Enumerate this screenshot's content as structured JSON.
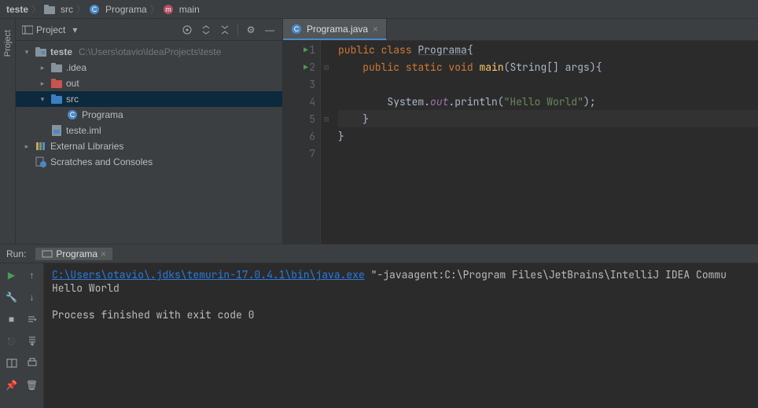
{
  "breadcrumbs": {
    "root": "teste",
    "folder": "src",
    "class": "Programa",
    "method": "main"
  },
  "project_panel": {
    "title": "Project",
    "root_name": "teste",
    "root_path": "C:\\Users\\otavio\\IdeaProjects\\teste",
    "items": {
      "idea": ".idea",
      "out": "out",
      "src": "src",
      "programa": "Programa",
      "iml": "teste.iml",
      "ext_libs": "External Libraries",
      "scratches": "Scratches and Consoles"
    }
  },
  "tabs": {
    "active": "Programa.java"
  },
  "code": {
    "l1_a": "public",
    "l1_b": " class ",
    "l1_c": "Programa",
    "l1_d": "{",
    "l2_a": "    public",
    "l2_b": " static",
    "l2_c": " void ",
    "l2_d": "main",
    "l2_e": "(String[] args)",
    "l2_f": "{",
    "l3": "",
    "l4_a": "        System.",
    "l4_b": "out",
    "l4_c": ".println(",
    "l4_d": "\"Hello World\"",
    "l4_e": ");",
    "l5": "    }",
    "l6": "}",
    "l7": ""
  },
  "gutter": {
    "n1": "1",
    "n2": "2",
    "n3": "3",
    "n4": "4",
    "n5": "5",
    "n6": "6",
    "n7": "7"
  },
  "run": {
    "label": "Run:",
    "config_name": "Programa",
    "java_path": "C:\\Users\\otavio\\.jdks\\temurin-17.0.4.1\\bin\\java.exe",
    "agent_args": " \"-javaagent:C:\\Program Files\\JetBrains\\IntelliJ IDEA Commu",
    "output": "Hello World",
    "exit": "Process finished with exit code 0"
  },
  "sidebar_tab": "Project"
}
